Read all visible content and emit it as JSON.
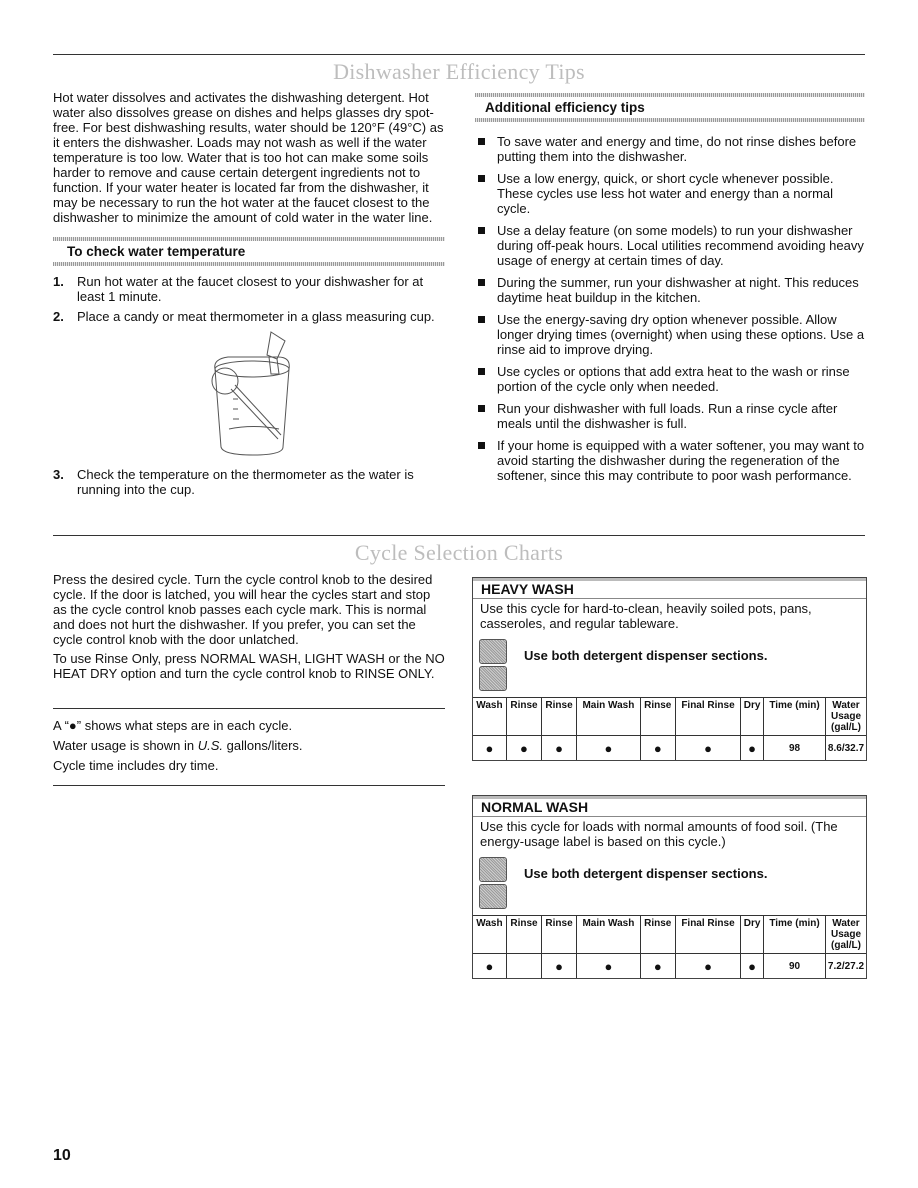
{
  "section1": {
    "title": "Dishwasher Efficiency Tips",
    "intro": "Hot water dissolves and activates the dishwashing detergent. Hot water also dissolves grease on dishes and helps glasses dry spot-free. For best dishwashing results, water should be 120°F (49°C) as it enters the dishwasher. Loads may not wash as well if the water temperature is too low. Water that is too hot can make some soils harder to remove and cause certain detergent ingredients not to function. If your water heater is located far from the dishwasher, it may be necessary to run the hot water at the faucet closest to the dishwasher to minimize the amount of cold water in the water line.",
    "check_heading": "To check water temperature",
    "steps": [
      {
        "num": "1.",
        "text": "Run hot water at the faucet closest to your dishwasher for at least 1 minute."
      },
      {
        "num": "2.",
        "text": "Place a candy or meat thermometer in a glass measuring cup."
      },
      {
        "num": "3.",
        "text": "Check the temperature on the thermometer as the water is running into the cup."
      }
    ],
    "tips_heading": "Additional efficiency tips",
    "tips": [
      "To save water and energy and time, do not rinse dishes before putting them into the dishwasher.",
      "Use a low energy, quick, or short cycle whenever possible. These cycles use less hot water and energy than a normal cycle.",
      "Use a delay feature (on some models) to run your dishwasher during off-peak hours. Local utilities recommend avoiding heavy usage of energy at certain times of day.",
      "During the summer, run your dishwasher at night. This reduces daytime heat buildup in the kitchen.",
      "Use the energy-saving dry option whenever possible. Allow longer drying times (overnight) when using these options. Use a rinse aid to improve drying.",
      "Use cycles or options that add extra heat to the wash or rinse portion of the cycle only when needed.",
      "Run your dishwasher with full loads. Run a rinse cycle after meals until the dishwasher is full.",
      "If your home is equipped with a water softener, you may want to avoid starting the dishwasher during the regeneration of the softener, since this may contribute to poor wash performance."
    ]
  },
  "section2": {
    "title": "Cycle Selection Charts",
    "para1": "Press the desired cycle. Turn the cycle control knob to the desired cycle. If the door is latched, you will hear the cycles start and stop as the cycle control knob passes each cycle mark. This is normal and does not hurt the dishwasher. If you prefer, you can set the cycle control knob with the door unlatched.",
    "para2": "To use Rinse Only, press NORMAL WASH, LIGHT WASH or the NO HEAT DRY option and turn the cycle control knob to RINSE ONLY.",
    "note1": "A “●” shows what steps are in each cycle.",
    "note2_pre": "Water usage is shown in ",
    "note2_em": "U.S.",
    "note2_post": " gallons/liters.",
    "note3": "Cycle time includes dry time.",
    "columns": [
      "Wash",
      "Rinse",
      "Rinse",
      "Main Wash",
      "Rinse",
      "Final Rinse",
      "Dry",
      "Time (min)",
      "Water Usage (gal/L)"
    ],
    "cycles": [
      {
        "name": "HEAVY WASH",
        "description": "Use this cycle for hard-to-clean, heavily soiled pots, pans, casseroles, and regular tableware.",
        "dispenser": "Use both detergent dispenser sections.",
        "row": [
          "●",
          "●",
          "●",
          "●",
          "●",
          "●",
          "●",
          "98",
          "8.6/32.7"
        ]
      },
      {
        "name": "NORMAL WASH",
        "description": "Use this cycle for loads with normal amounts of food soil. (The energy-usage label is based on this cycle.)",
        "dispenser": "Use both detergent dispenser sections.",
        "row": [
          "●",
          "",
          "●",
          "●",
          "●",
          "●",
          "●",
          "90",
          "7.2/27.2"
        ]
      }
    ]
  },
  "page_number": "10"
}
